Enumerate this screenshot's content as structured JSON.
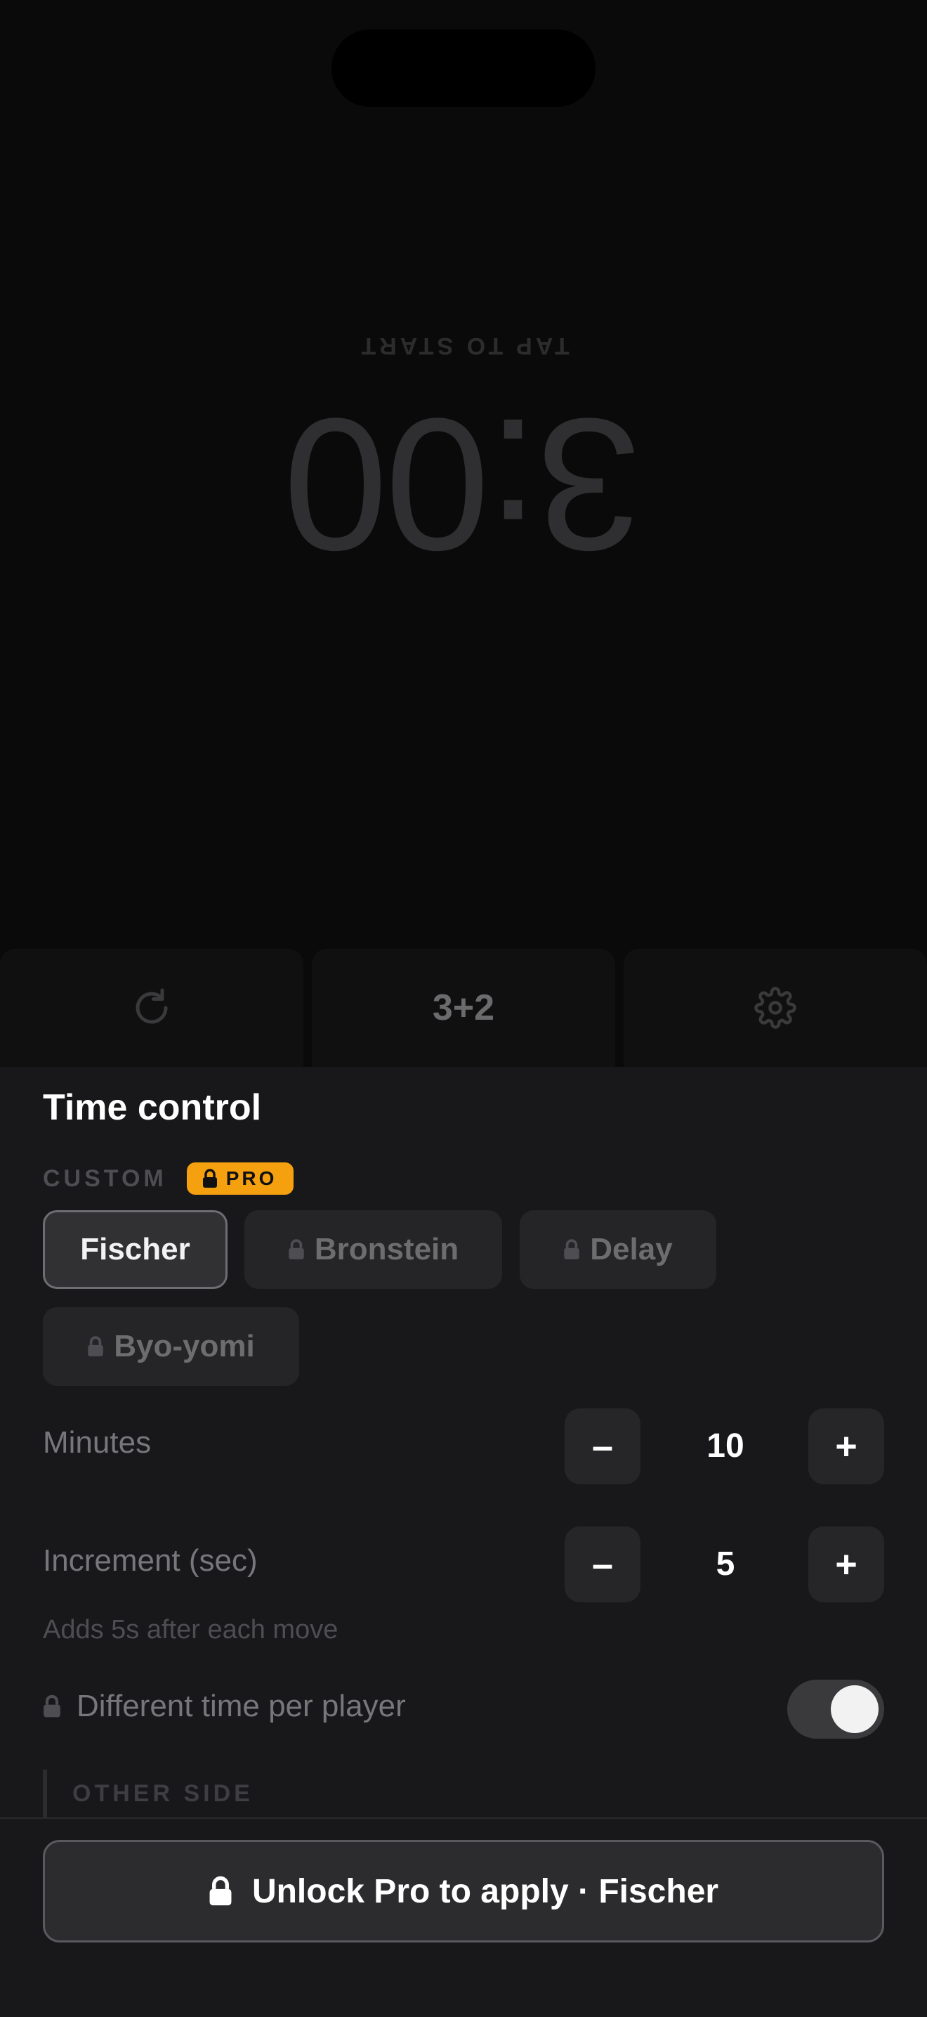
{
  "clock": {
    "tap_label": "TAP TO START",
    "time": "3:00"
  },
  "control_bar": {
    "preset_label": "3+2"
  },
  "sheet": {
    "title": "Time control",
    "section_label": "CUSTOM",
    "pro_badge": "PRO",
    "modes": [
      {
        "label": "Fischer",
        "locked": false,
        "selected": true
      },
      {
        "label": "Bronstein",
        "locked": true,
        "selected": false
      },
      {
        "label": "Delay",
        "locked": true,
        "selected": false
      },
      {
        "label": "Byo-yomi",
        "locked": true,
        "selected": false
      }
    ],
    "minutes": {
      "label": "Minutes",
      "value": "10",
      "minus": "–",
      "plus": "+"
    },
    "increment": {
      "label": "Increment (sec)",
      "value": "5",
      "minus": "–",
      "plus": "+"
    },
    "increment_hint": "Adds 5s after each move",
    "different_time": {
      "label": "Different time per player",
      "enabled": true
    },
    "other_side_label": "OTHER SIDE",
    "cta_label": "Unlock Pro to apply · Fischer"
  },
  "colors": {
    "pro_accent": "#f5a00f",
    "sheet_bg": "#18181a"
  }
}
